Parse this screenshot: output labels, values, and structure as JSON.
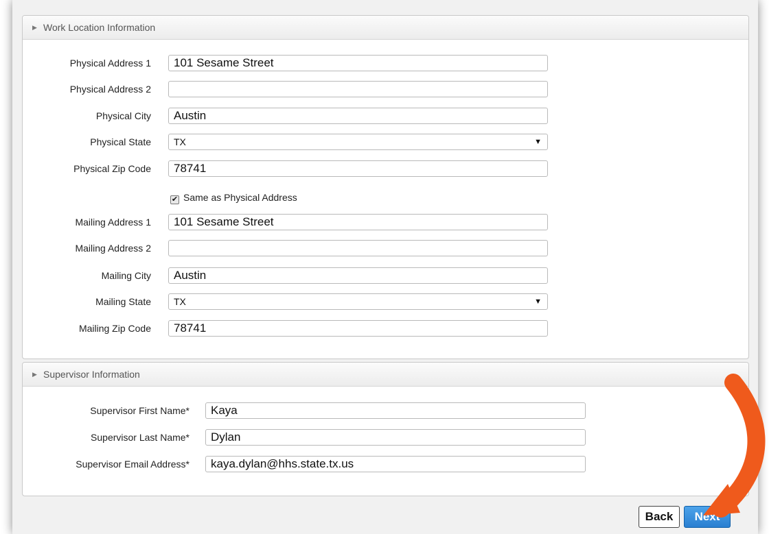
{
  "work_location": {
    "header": "Work Location Information",
    "fields": [
      {
        "label": "Physical Address 1",
        "value": "101 Sesame Street",
        "type": "text"
      },
      {
        "label": "Physical Address 2",
        "value": "",
        "type": "text"
      },
      {
        "label": "Physical City",
        "value": "Austin",
        "type": "text"
      },
      {
        "label": "Physical State",
        "value": "TX",
        "type": "select"
      },
      {
        "label": "Physical Zip Code",
        "value": "78741",
        "type": "text"
      }
    ],
    "same_as_label": "Same as Physical Address",
    "same_as_checked": true,
    "mailing_fields": [
      {
        "label": "Mailing Address 1",
        "value": "101 Sesame Street",
        "type": "text"
      },
      {
        "label": "Mailing Address 2",
        "value": "",
        "type": "text"
      },
      {
        "label": "Mailing City",
        "value": "Austin",
        "type": "text"
      },
      {
        "label": "Mailing State",
        "value": "TX",
        "type": "select"
      },
      {
        "label": "Mailing Zip Code",
        "value": "78741",
        "type": "text"
      }
    ]
  },
  "supervisor": {
    "header": "Supervisor Information",
    "fields": [
      {
        "label": "Supervisor First Name*",
        "value": "Kaya"
      },
      {
        "label": "Supervisor Last Name*",
        "value": "Dylan"
      },
      {
        "label": "Supervisor Email Address*",
        "value": "kaya.dylan@hhs.state.tx.us"
      }
    ]
  },
  "buttons": {
    "back": "Back",
    "next": "Next"
  },
  "colors": {
    "next_button": "#2a7fd1",
    "callout_arrow": "#ef5a1c"
  },
  "icons": {
    "panel_toggle": "triangle-right-icon",
    "dropdown": "chevron-down-icon",
    "checkbox": "checkmark-icon"
  }
}
